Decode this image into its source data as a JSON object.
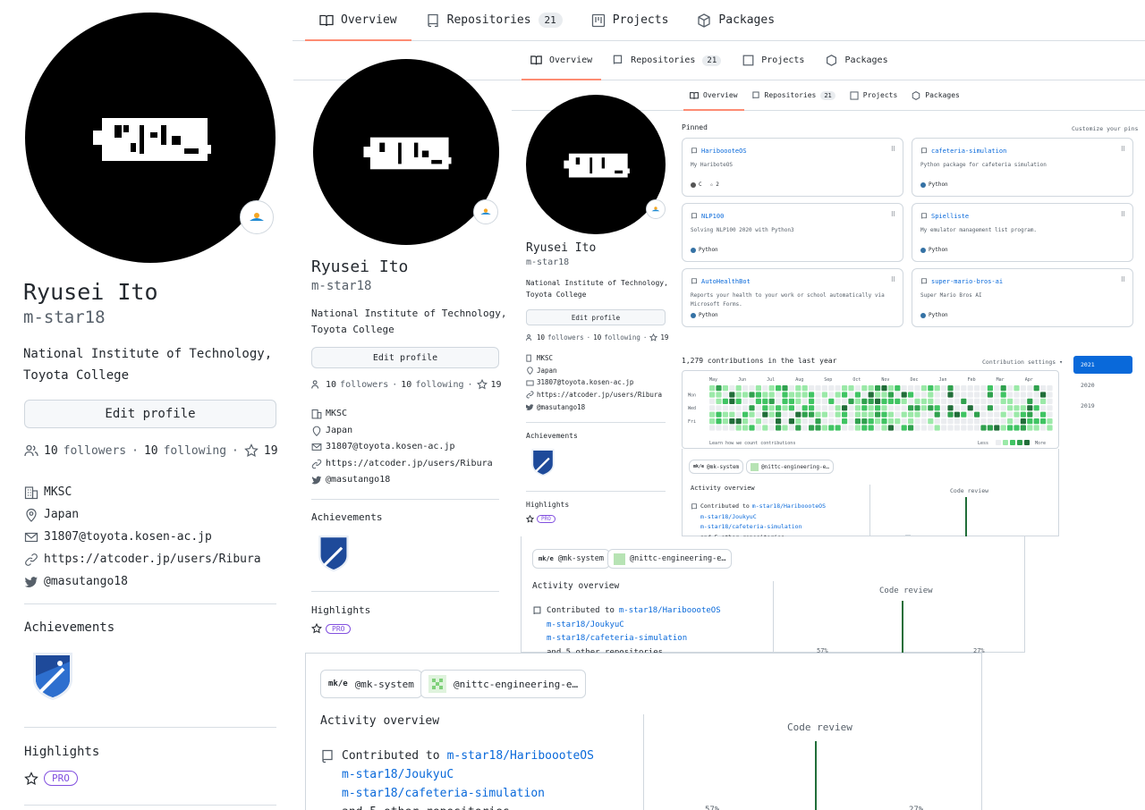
{
  "tabs": {
    "overview": "Overview",
    "repositories": "Repositories",
    "repo_count": "21",
    "projects": "Projects",
    "packages": "Packages"
  },
  "profile": {
    "name": "Ryusei Ito",
    "username": "m-star18",
    "bio_line1": "National Institute of Technology,",
    "bio_line2": "Toyota College",
    "edit_profile": "Edit profile",
    "followers_count": "10",
    "followers_label": "followers",
    "following_count": "10",
    "following_label": "following",
    "stars": "19",
    "org": "MKSC",
    "location": "Japan",
    "email": "31807@toyota.kosen-ac.jp",
    "website": "https://atcoder.jp/users/Ribura",
    "twitter": "@masutango18",
    "achievements": "Achievements",
    "highlights": "Highlights",
    "pro": "PRO"
  },
  "pinned": {
    "title": "Pinned",
    "customize": "Customize your pins",
    "repos": [
      {
        "name": "HariboooteOS",
        "desc": "My HariboteOS",
        "lang": "C",
        "lang_color": "#555555",
        "stars": "2"
      },
      {
        "name": "cafeteria-simulation",
        "desc": "Python package for cafeteria simulation",
        "lang": "Python",
        "lang_color": "#3572A5"
      },
      {
        "name": "NLP100",
        "desc": "Solving NLP100 2020 with Python3",
        "lang": "Python",
        "lang_color": "#3572A5"
      },
      {
        "name": "Spielliste",
        "desc": "My emulator management list program.",
        "lang": "Python",
        "lang_color": "#3572A5"
      },
      {
        "name": "AutoHealthBot",
        "desc": "Reports your health to your work or school automatically via Microsoft Forms.",
        "lang": "Python",
        "lang_color": "#3572A5"
      },
      {
        "name": "super-mario-bros-ai",
        "desc": "Super Mario Bros AI",
        "lang": "Python",
        "lang_color": "#3572A5"
      }
    ]
  },
  "contrib": {
    "title": "1,279 contributions in the last year",
    "settings": "Contribution settings",
    "months": [
      "May",
      "Jun",
      "Jul",
      "Aug",
      "Sep",
      "Oct",
      "Nov",
      "Dec",
      "Jan",
      "Feb",
      "Mar",
      "Apr"
    ],
    "days": [
      "Mon",
      "Wed",
      "Fri"
    ],
    "learn": "Learn how we count contributions",
    "less": "Less",
    "more": "More",
    "years": [
      "2021",
      "2020",
      "2019"
    ]
  },
  "activity": {
    "orgs": [
      "@mk-system",
      "@nittc-engineering-e…"
    ],
    "org_logo_text": "mk/e",
    "overview_title": "Activity overview",
    "contributed_to": "Contributed to",
    "repo1": "m-star18/HariboooteOS",
    "repo2": "m-star18/JoukyuC",
    "repo3": "m-star18/cafeteria-simulation",
    "more": "and 5 other repositories",
    "code_review": "Code review",
    "pct_left": "57%",
    "pct_right": "27%"
  },
  "colors": {
    "accent": "#fd8c73",
    "link": "#0969da",
    "pro": "#8250df",
    "green": [
      "#ebedf0",
      "#9be9a8",
      "#40c463",
      "#30a14e",
      "#216e39"
    ]
  }
}
